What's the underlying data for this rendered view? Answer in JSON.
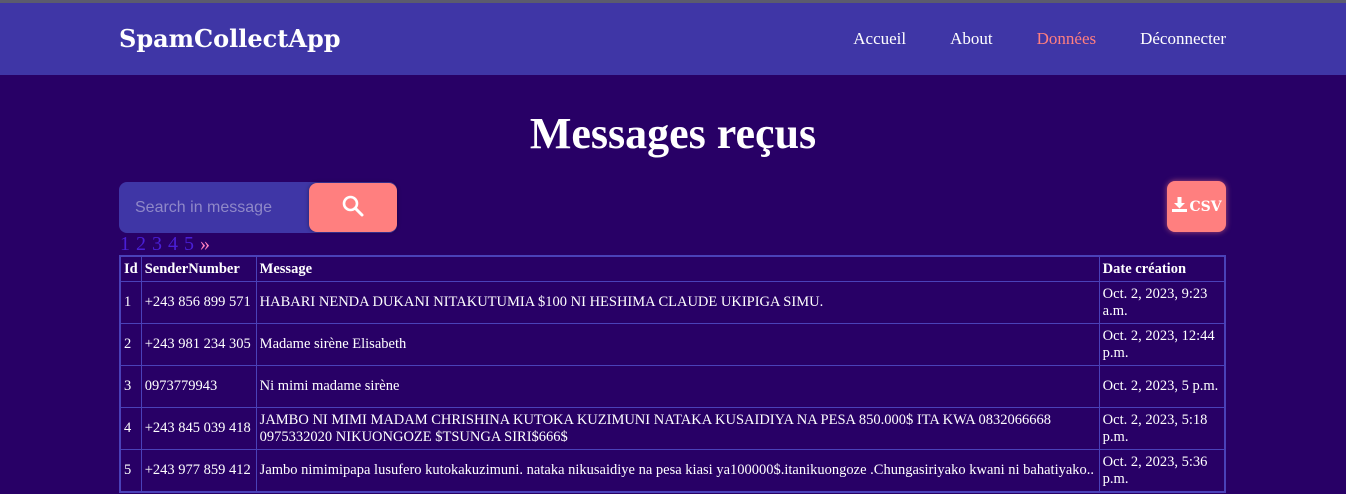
{
  "navbar": {
    "brand": "SpamCollectApp",
    "links": [
      "Accueil",
      "About",
      "Données",
      "Déconnecter"
    ],
    "active_link": "Données"
  },
  "page": {
    "title": "Messages reçus"
  },
  "search": {
    "placeholder": "Search in message",
    "value": ""
  },
  "csv_button": {
    "label": "CSV"
  },
  "pagination": {
    "pages": [
      "1",
      "2",
      "3",
      "4",
      "5"
    ],
    "next": "»"
  },
  "table": {
    "headers": [
      "Id",
      "SenderNumber",
      "Message",
      "Date création"
    ],
    "rows": [
      [
        "1",
        "+243 856 899 571",
        "HABARI NENDA DUKANI NITAKUTUMIA $100 NI HESHIMA CLAUDE UKIPIGA SIMU.",
        "Oct. 2, 2023, 9:23 a.m."
      ],
      [
        "2",
        "+243 981 234 305",
        "Madame sirène Elisabeth",
        "Oct. 2, 2023, 12:44 p.m."
      ],
      [
        "3",
        "0973779943",
        "Ni mimi madame sirène",
        "Oct. 2, 2023, 5 p.m."
      ],
      [
        "4",
        "+243 845 039 418",
        "JAMBO NI MIMI MADAM CHRISHINA KUTOKA KUZIMUNI NATAKA KUSAIDIYA NA PESA 850.000$ ITA KWA 0832066668 0975332020 NIKUONGOZE $TSUNGA SIRI$666$",
        "Oct. 2, 2023, 5:18 p.m."
      ],
      [
        "5",
        "+243 977 859 412",
        "Jambo nimimipapa lusufero kutokakuzimuni. nataka nikusaidiye na pesa kiasi ya100000$.itanikuongoze .Chungasiriyako kwani ni bahatiyako..",
        "Oct. 2, 2023, 5:36 p.m."
      ]
    ]
  },
  "colors": {
    "background": "#280066",
    "navbar": "#3f36a6",
    "accent": "#ff7f7f",
    "active_link": "#ff7f7f"
  },
  "icons": {
    "search": "search-icon",
    "download": "download-icon"
  }
}
